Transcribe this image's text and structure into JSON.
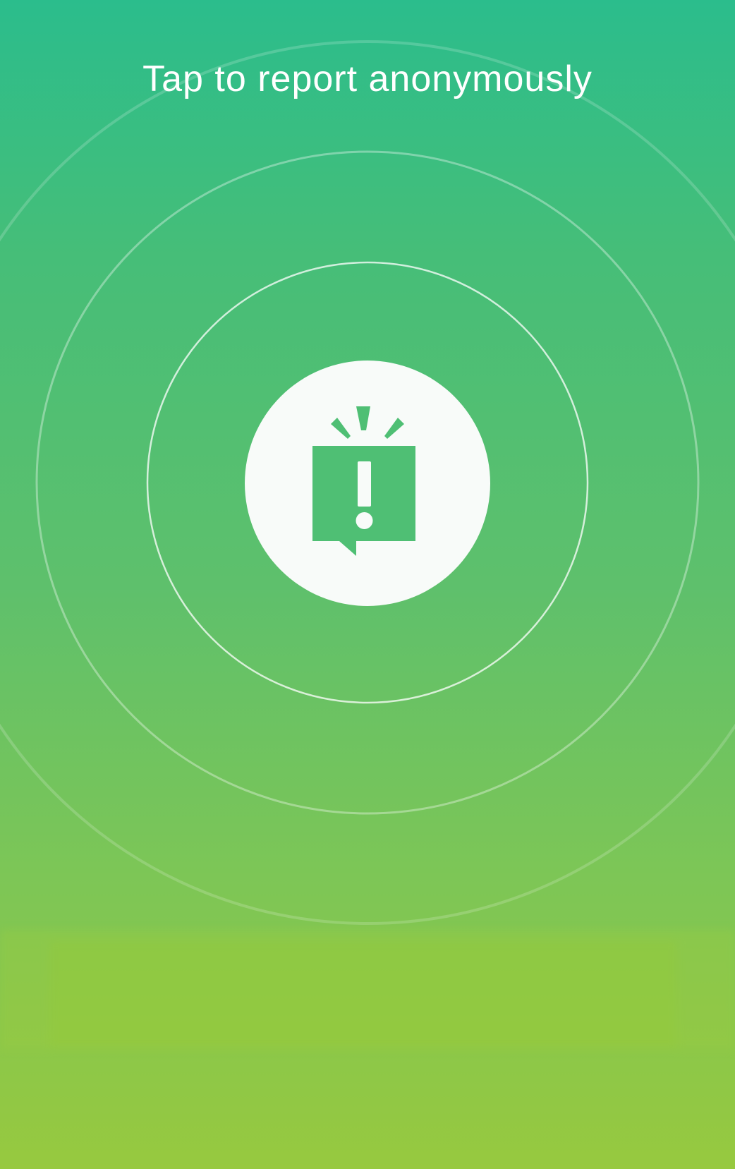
{
  "prompt": {
    "text": "Tap to report anonymously"
  },
  "report_button": {
    "icon": "alert-speech-bubble-icon"
  },
  "colors": {
    "gradient_top": "#2bbd8c",
    "gradient_bottom": "#97c93f",
    "icon_green": "#4fbf74",
    "button_fill": "#f8fbf9"
  }
}
